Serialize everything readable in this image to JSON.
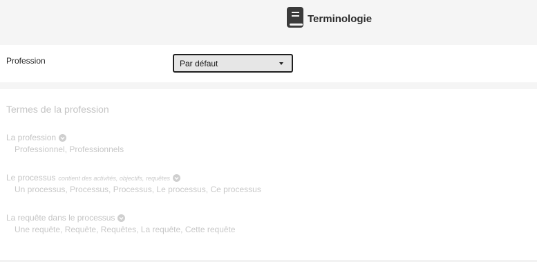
{
  "header": {
    "icon": "book-icon",
    "title": "Terminologie"
  },
  "profession": {
    "label": "Profession",
    "select": {
      "value": "Par défaut"
    }
  },
  "terms_section": {
    "title": "Termes de la profession",
    "terms": [
      {
        "label": "La profession",
        "note": "",
        "values": "Professionnel, Professionnels"
      },
      {
        "label": "Le processus",
        "note": "contient des activités, objectifs, requêtes",
        "values": "Un processus, Processus, Processus, Le processus, Ce processus"
      },
      {
        "label": "La requête dans le processus",
        "note": "",
        "values": "Une requête, Requête, Requêtes, La requête, Cette requête"
      }
    ]
  },
  "colors": {
    "header_bg": "#f5f5f5",
    "select_bg": "#e6e6e6",
    "disabled_text": "#c4c4c4",
    "title_text": "#2b2b2b"
  }
}
